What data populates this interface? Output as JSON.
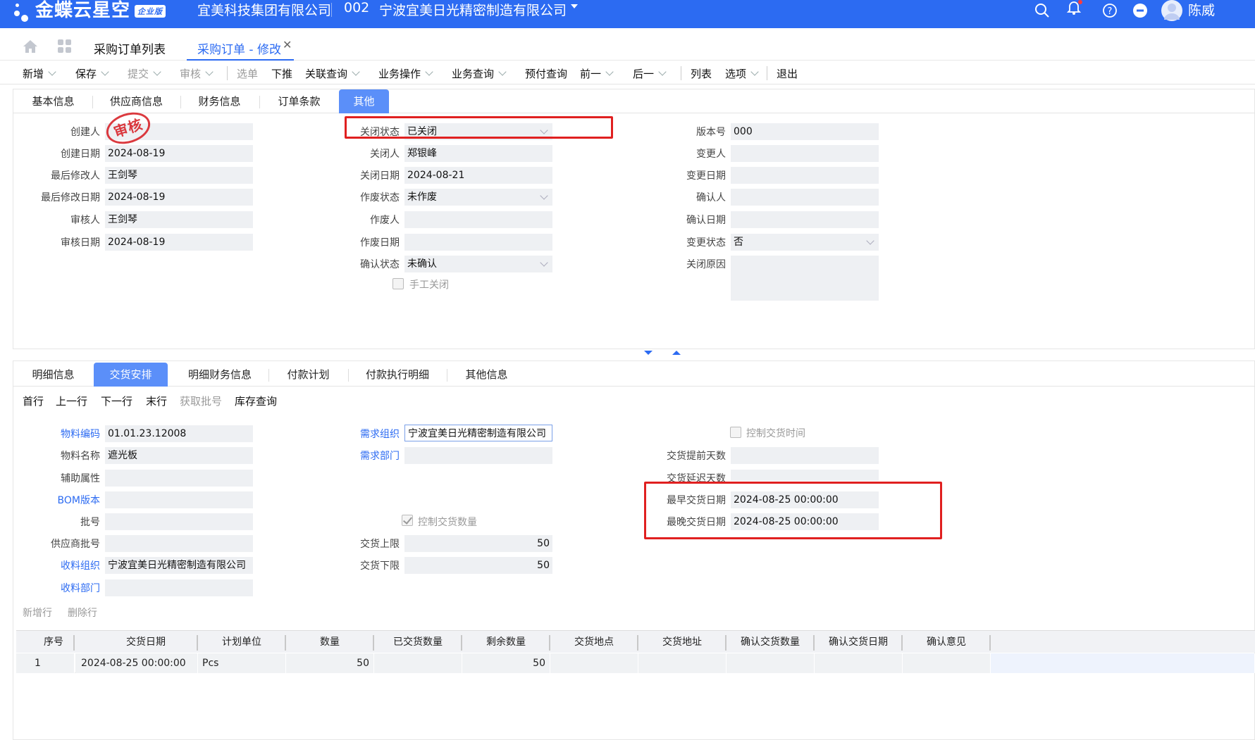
{
  "topbar": {
    "logo_text": "金蝶云星空",
    "logo_badge": "企业版",
    "company": "宜美科技集团有限公司",
    "org_code": "002",
    "org_name": "宁波宜美日光精密制造有限公司",
    "user_name": "陈威",
    "icons": [
      "search-icon",
      "bell-icon",
      "help-icon",
      "more-icon",
      "avatar"
    ],
    "accent": "#2c6bf2"
  },
  "tabs": {
    "list_label": "采购订单列表",
    "edit_label": "采购订单 - 修改"
  },
  "toolbar": {
    "new": "新增",
    "save": "保存",
    "submit": "提交",
    "audit": "审核",
    "select_order": "选单",
    "push_down": "下推",
    "related_query": "关联查询",
    "business_op": "业务操作",
    "business_query": "业务查询",
    "prepay_query": "预付查询",
    "prev": "前一",
    "next": "后一",
    "list": "列表",
    "options": "选项",
    "exit": "退出"
  },
  "header_tabs": [
    "基本信息",
    "供应商信息",
    "财务信息",
    "订单条款",
    "其他"
  ],
  "other": {
    "creator_label": "创建人",
    "creator_value": "",
    "create_date_label": "创建日期",
    "create_date": "2024-08-19",
    "modifier_label": "最后修改人",
    "modifier": "王剑琴",
    "modify_date_label": "最后修改日期",
    "modify_date": "2024-08-19",
    "auditor_label": "审核人",
    "auditor": "王剑琴",
    "audit_date_label": "审核日期",
    "audit_date": "2024-08-19",
    "close_status_label": "关闭状态",
    "close_status": "已关闭",
    "closer_label": "关闭人",
    "closer": "郑银峰",
    "close_date_label": "关闭日期",
    "close_date": "2024-08-21",
    "cancel_status_label": "作废状态",
    "cancel_status": "未作废",
    "canceller_label": "作废人",
    "canceller": "",
    "cancel_date_label": "作废日期",
    "cancel_date": "",
    "confirm_status_label": "确认状态",
    "confirm_status": "未确认",
    "manual_close_label": "手工关闭",
    "version_label": "版本号",
    "version": "000",
    "changer_label": "变更人",
    "changer": "",
    "change_date_label": "变更日期",
    "change_date": "",
    "confirmer_label": "确认人",
    "confirmer": "",
    "confirm_date_label": "确认日期",
    "confirm_date": "",
    "change_status_label": "变更状态",
    "change_status": "否",
    "close_reason_label": "关闭原因",
    "close_reason": "",
    "stamp_text": "审核"
  },
  "detail_tabs": [
    "明细信息",
    "交货安排",
    "明细财务信息",
    "付款计划",
    "付款执行明细",
    "其他信息"
  ],
  "nav": {
    "first": "首行",
    "prev": "上一行",
    "next": "下一行",
    "last": "末行",
    "get_batch": "获取批号",
    "stock_query": "库存查询"
  },
  "delivery": {
    "material_code_label": "物料编码",
    "material_code": "01.01.23.12008",
    "material_name_label": "物料名称",
    "material_name": "遮光板",
    "aux_label": "辅助属性",
    "aux": "",
    "bom_label": "BOM版本",
    "bom": "",
    "lot_label": "批号",
    "lot": "",
    "supplier_lot_label": "供应商批号",
    "supplier_lot": "",
    "receive_org_label": "收料组织",
    "receive_org": "宁波宜美日光精密制造有限公司",
    "receive_dept_label": "收料部门",
    "receive_dept": "",
    "demand_org_label": "需求组织",
    "demand_org": "宁波宜美日光精密制造有限公司",
    "demand_dept_label": "需求部门",
    "demand_dept": "",
    "control_qty_label": "控制交货数量",
    "upper_label": "交货上限",
    "upper": "50",
    "lower_label": "交货下限",
    "lower": "50",
    "control_time_label": "控制交货时间",
    "advance_days_label": "交货提前天数",
    "advance_days": "",
    "delay_days_label": "交货延迟天数",
    "delay_days": "",
    "earliest_label": "最早交货日期",
    "earliest": "2024-08-25 00:00:00",
    "latest_label": "最晚交货日期",
    "latest": "2024-08-25 00:00:00"
  },
  "grid_actions": {
    "add_row": "新增行",
    "delete_row": "删除行"
  },
  "grid": {
    "columns": [
      "序号",
      "交货日期",
      "计划单位",
      "数量",
      "已交货数量",
      "剩余数量",
      "交货地点",
      "交货地址",
      "确认交货数量",
      "确认交货日期",
      "确认意见"
    ],
    "rows": [
      {
        "seq": "1",
        "date": "2024-08-25 00:00:00",
        "unit": "Pcs",
        "qty": "50",
        "delivered": "",
        "remaining": "50",
        "place": "",
        "address": "",
        "confirm_qty": "",
        "confirm_date": "",
        "opinion": ""
      }
    ]
  }
}
